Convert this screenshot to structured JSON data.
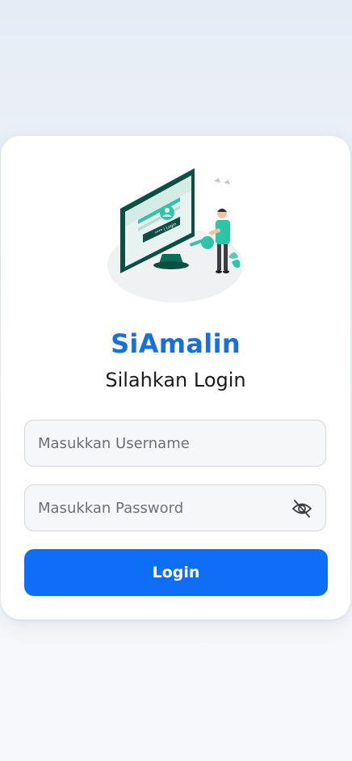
{
  "login": {
    "app_title": "SiAmalin",
    "subtitle": "Silahkan Login",
    "username": {
      "placeholder": "Masukkan Username",
      "value": ""
    },
    "password": {
      "placeholder": "Masukkan Password",
      "value": "",
      "toggle_icon": "eye-off-icon"
    },
    "submit_label": "Login",
    "illustration_text": "**** | Login"
  },
  "colors": {
    "brand": "#1a6fe0",
    "button": "#0f6ef7",
    "illustration_accent": "#2ec4a6",
    "illustration_dark": "#0e4f44"
  }
}
